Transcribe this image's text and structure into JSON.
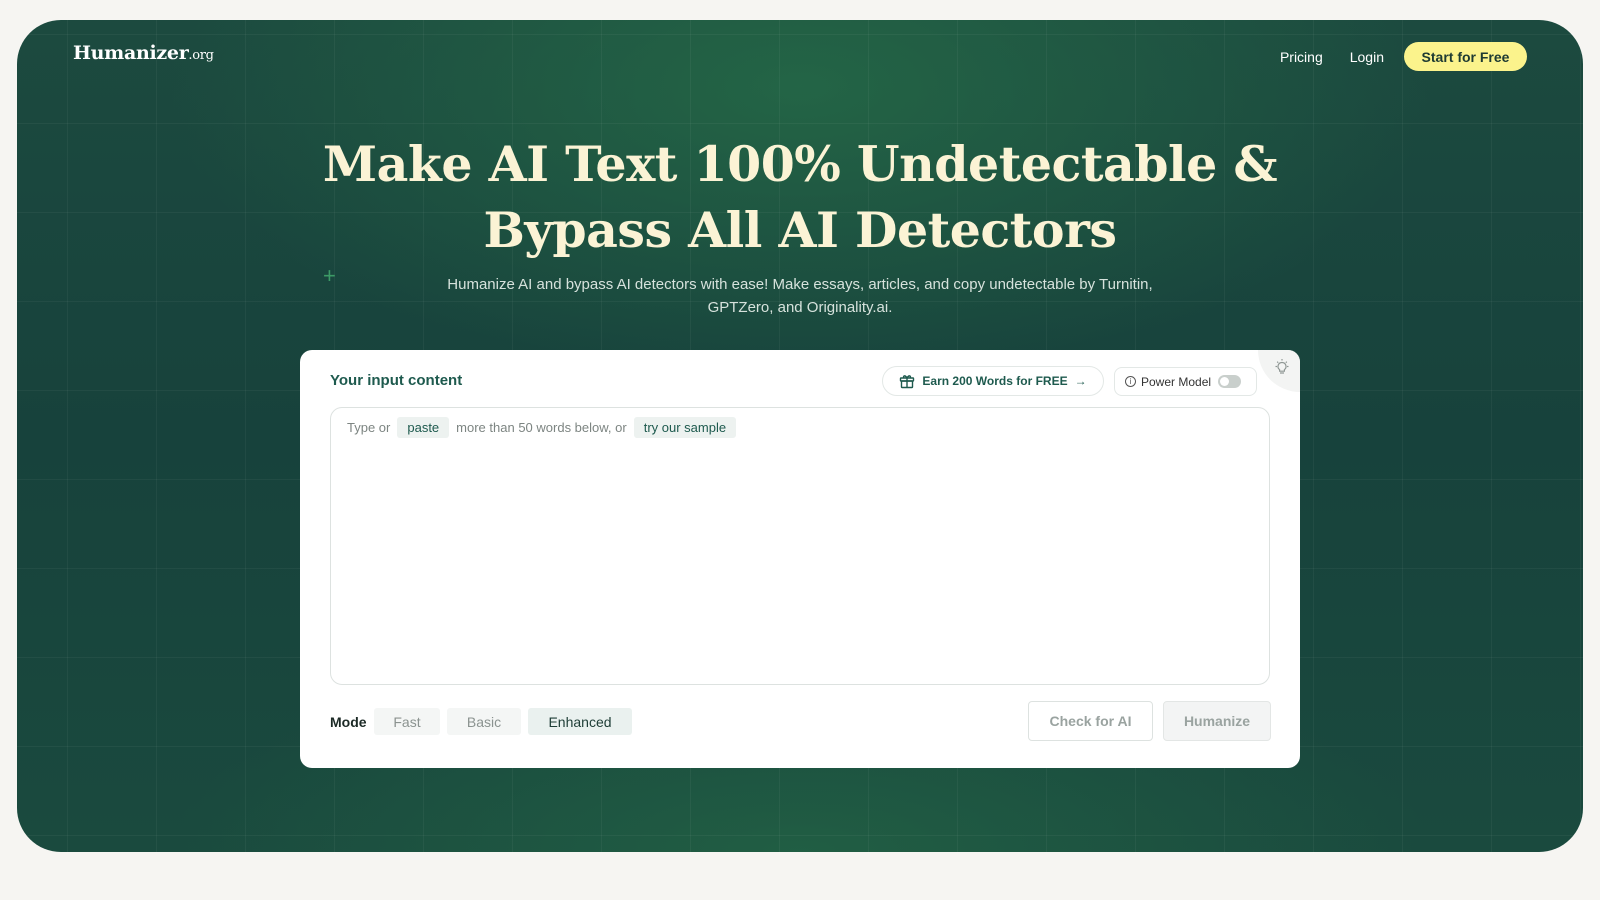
{
  "header": {
    "logo_main": "Humanizer",
    "logo_tld": ".org",
    "nav": {
      "pricing": "Pricing",
      "login": "Login",
      "cta": "Start for Free"
    }
  },
  "hero": {
    "title_line1": "Make AI Text 100% Undetectable &",
    "title_line2": "Bypass All AI Detectors",
    "subtitle": "Humanize AI and bypass AI detectors with ease! Make essays, articles, and copy undetectable by Turnitin, GPTZero, and Originality.ai."
  },
  "card": {
    "label": "Your input content",
    "earn_button": "Earn 200 Words for FREE",
    "power_model_label": "Power Model",
    "power_model_on": false,
    "placeholder": {
      "part1": "Type or",
      "paste_chip": "paste",
      "part2": "more than 50 words below, or",
      "sample_chip": "try our sample"
    },
    "mode_label": "Mode",
    "modes": [
      "Fast",
      "Basic",
      "Enhanced"
    ],
    "selected_mode": "Enhanced",
    "check_button": "Check for AI",
    "humanize_button": "Humanize"
  },
  "colors": {
    "cta_bg": "#fbf38c",
    "hero_bg": "#17423c",
    "title_text": "#fbf3d5",
    "accent_text": "#1e5a4e"
  },
  "icons": [
    "gift-icon",
    "arrow-right-icon",
    "info-icon",
    "lightbulb-icon",
    "plus-decoration-icon"
  ]
}
